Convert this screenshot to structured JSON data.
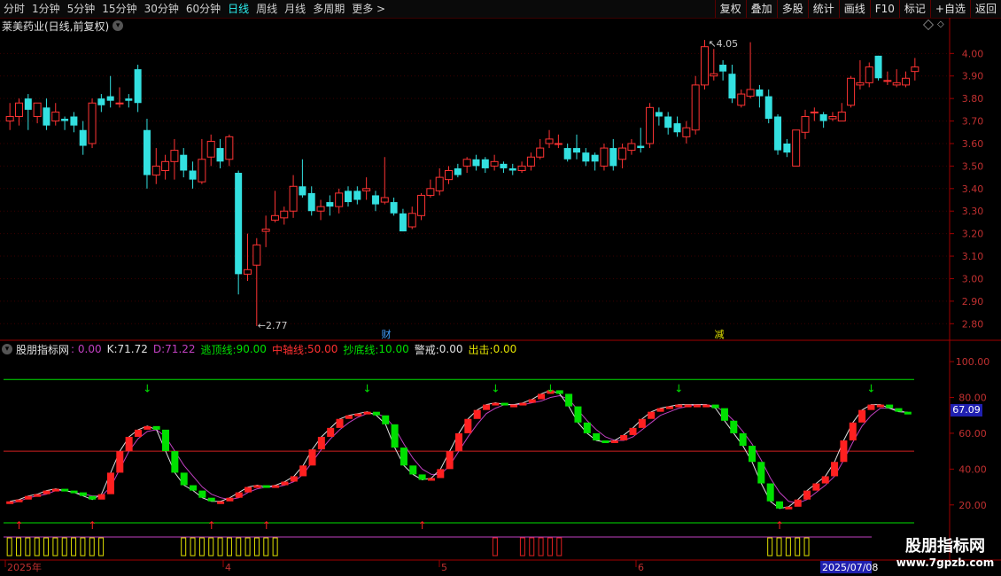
{
  "toolbar": {
    "periods": [
      "分时",
      "1分钟",
      "5分钟",
      "15分钟",
      "30分钟",
      "60分钟",
      "日线",
      "周线",
      "月线",
      "多周期",
      "更多 >"
    ],
    "active_period": "日线",
    "right_buttons": [
      "复权",
      "叠加",
      "多股",
      "统计",
      "画线",
      "F10",
      "标记",
      "+自选",
      "返回"
    ]
  },
  "stock": {
    "title": "莱美药业(日线,前复权)",
    "high_label": "4.05",
    "low_label": "2.77",
    "events": [
      "财",
      "减"
    ]
  },
  "indicator": {
    "name": "股朋指标网",
    "k_label": "K:",
    "k_value": "71.72",
    "d_label": "D:",
    "d_value": "71.22",
    "top_label": "逃顶线:",
    "top_value": "90.00",
    "mid_label": "中轴线:",
    "mid_value": "50.00",
    "bottom_label": "抄底线:",
    "bottom_value": "10.00",
    "warn_label": "警戒:",
    "warn_value": "0.00",
    "out_label": "出击:",
    "out_value": "0.00",
    "first_value": ": 0.00",
    "current_value": "67.09"
  },
  "watermark": {
    "line1": "股朋指标网",
    "line2": "www.7gpzb.com"
  },
  "date_axis": {
    "labels": [
      "2025年",
      "4",
      "5",
      "6"
    ],
    "cursor_date": "2025/07/08"
  },
  "colors": {
    "up": "#ff3333",
    "down": "#33e0e0",
    "green": "#00e000",
    "red_line": "#d02020",
    "purple": "#c040c0",
    "yellow": "#e0e000"
  },
  "chart_data": [
    {
      "type": "candlestick",
      "y_ticks": [
        4.0,
        3.9,
        3.8,
        3.7,
        3.6,
        3.5,
        3.4,
        3.3,
        3.2,
        3.1,
        3.0,
        2.9,
        2.8
      ],
      "ylim": [
        2.75,
        4.08
      ],
      "candles": [
        [
          3.7,
          3.72,
          3.78,
          3.66
        ],
        [
          3.72,
          3.78,
          3.8,
          3.68
        ],
        [
          3.8,
          3.75,
          3.82,
          3.66
        ],
        [
          3.72,
          3.78,
          3.78,
          3.69
        ],
        [
          3.76,
          3.68,
          3.8,
          3.66
        ],
        [
          3.7,
          3.74,
          3.78,
          3.68
        ],
        [
          3.71,
          3.7,
          3.72,
          3.66
        ],
        [
          3.72,
          3.68,
          3.74,
          3.65
        ],
        [
          3.66,
          3.59,
          3.7,
          3.55
        ],
        [
          3.6,
          3.78,
          3.8,
          3.58
        ],
        [
          3.8,
          3.77,
          3.82,
          3.74
        ],
        [
          3.81,
          3.79,
          3.9,
          3.76
        ],
        [
          3.78,
          3.78,
          3.85,
          3.76
        ],
        [
          3.8,
          3.79,
          3.82,
          3.76
        ],
        [
          3.93,
          3.78,
          3.95,
          3.74
        ],
        [
          3.66,
          3.46,
          3.71,
          3.4
        ],
        [
          3.46,
          3.5,
          3.58,
          3.42
        ],
        [
          3.48,
          3.52,
          3.55,
          3.44
        ],
        [
          3.52,
          3.57,
          3.62,
          3.44
        ],
        [
          3.55,
          3.48,
          3.58,
          3.45
        ],
        [
          3.48,
          3.44,
          3.52,
          3.4
        ],
        [
          3.43,
          3.53,
          3.62,
          3.42
        ],
        [
          3.54,
          3.61,
          3.64,
          3.5
        ],
        [
          3.58,
          3.52,
          3.62,
          3.49
        ],
        [
          3.53,
          3.63,
          3.64,
          3.5
        ],
        [
          3.47,
          3.02,
          3.48,
          2.93
        ],
        [
          3.02,
          3.04,
          3.2,
          2.99
        ],
        [
          3.06,
          3.15,
          3.18,
          2.79
        ],
        [
          3.21,
          3.22,
          3.28,
          3.14
        ],
        [
          3.26,
          3.28,
          3.39,
          3.25
        ],
        [
          3.27,
          3.3,
          3.32,
          3.24
        ],
        [
          3.3,
          3.41,
          3.46,
          3.27
        ],
        [
          3.41,
          3.37,
          3.53,
          3.36
        ],
        [
          3.38,
          3.3,
          3.41,
          3.28
        ],
        [
          3.3,
          3.32,
          3.35,
          3.26
        ],
        [
          3.34,
          3.32,
          3.37,
          3.28
        ],
        [
          3.32,
          3.38,
          3.4,
          3.29
        ],
        [
          3.39,
          3.34,
          3.41,
          3.32
        ],
        [
          3.39,
          3.35,
          3.41,
          3.33
        ],
        [
          3.39,
          3.4,
          3.45,
          3.35
        ],
        [
          3.37,
          3.33,
          3.39,
          3.3
        ],
        [
          3.34,
          3.36,
          3.54,
          3.33
        ],
        [
          3.34,
          3.29,
          3.36,
          3.28
        ],
        [
          3.29,
          3.21,
          3.31,
          3.21
        ],
        [
          3.23,
          3.29,
          3.32,
          3.22
        ],
        [
          3.28,
          3.37,
          3.38,
          3.26
        ],
        [
          3.37,
          3.4,
          3.44,
          3.36
        ],
        [
          3.39,
          3.45,
          3.49,
          3.37
        ],
        [
          3.44,
          3.48,
          3.5,
          3.42
        ],
        [
          3.49,
          3.46,
          3.51,
          3.45
        ],
        [
          3.5,
          3.53,
          3.54,
          3.47
        ],
        [
          3.53,
          3.5,
          3.55,
          3.48
        ],
        [
          3.53,
          3.49,
          3.54,
          3.47
        ],
        [
          3.5,
          3.52,
          3.55,
          3.48
        ],
        [
          3.51,
          3.49,
          3.52,
          3.47
        ],
        [
          3.49,
          3.48,
          3.51,
          3.46
        ],
        [
          3.48,
          3.5,
          3.52,
          3.47
        ],
        [
          3.5,
          3.54,
          3.56,
          3.48
        ],
        [
          3.54,
          3.58,
          3.62,
          3.53
        ],
        [
          3.6,
          3.62,
          3.66,
          3.58
        ],
        [
          3.6,
          3.6,
          3.64,
          3.58
        ],
        [
          3.58,
          3.53,
          3.6,
          3.52
        ],
        [
          3.58,
          3.56,
          3.64,
          3.53
        ],
        [
          3.56,
          3.52,
          3.58,
          3.5
        ],
        [
          3.55,
          3.52,
          3.56,
          3.48
        ],
        [
          3.5,
          3.58,
          3.6,
          3.48
        ],
        [
          3.58,
          3.5,
          3.62,
          3.48
        ],
        [
          3.53,
          3.58,
          3.6,
          3.49
        ],
        [
          3.57,
          3.6,
          3.62,
          3.55
        ],
        [
          3.59,
          3.58,
          3.67,
          3.56
        ],
        [
          3.6,
          3.76,
          3.78,
          3.58
        ],
        [
          3.74,
          3.72,
          3.76,
          3.68
        ],
        [
          3.72,
          3.67,
          3.74,
          3.64
        ],
        [
          3.69,
          3.65,
          3.72,
          3.63
        ],
        [
          3.63,
          3.67,
          3.7,
          3.6
        ],
        [
          3.66,
          3.86,
          3.9,
          3.64
        ],
        [
          3.86,
          4.03,
          4.06,
          3.84
        ],
        [
          3.9,
          3.91,
          4.02,
          3.88
        ],
        [
          3.95,
          3.92,
          3.97,
          3.88
        ],
        [
          3.91,
          3.8,
          3.95,
          3.78
        ],
        [
          3.77,
          3.82,
          3.84,
          3.76
        ],
        [
          3.81,
          3.84,
          4.05,
          3.8
        ],
        [
          3.84,
          3.81,
          3.86,
          3.76
        ],
        [
          3.81,
          3.71,
          3.84,
          3.69
        ],
        [
          3.72,
          3.57,
          3.73,
          3.55
        ],
        [
          3.6,
          3.56,
          3.62,
          3.54
        ],
        [
          3.5,
          3.66,
          3.66,
          3.5
        ],
        [
          3.65,
          3.72,
          3.75,
          3.62
        ],
        [
          3.74,
          3.74,
          3.76,
          3.7
        ],
        [
          3.73,
          3.7,
          3.74,
          3.67
        ],
        [
          3.71,
          3.72,
          3.74,
          3.7
        ],
        [
          3.7,
          3.74,
          3.78,
          3.7
        ],
        [
          3.77,
          3.89,
          3.9,
          3.76
        ],
        [
          3.86,
          3.87,
          3.97,
          3.84
        ],
        [
          3.87,
          3.94,
          3.96,
          3.85
        ],
        [
          3.99,
          3.89,
          3.99,
          3.88
        ],
        [
          3.88,
          3.88,
          3.92,
          3.86
        ],
        [
          3.86,
          3.87,
          3.93,
          3.85
        ],
        [
          3.86,
          3.89,
          3.92,
          3.85
        ],
        [
          3.92,
          3.94,
          3.98,
          3.88
        ]
      ]
    },
    {
      "type": "line",
      "y_ticks": [
        100,
        80,
        60,
        40,
        20
      ],
      "ylim": [
        10,
        103
      ],
      "series": [
        {
          "name": "K",
          "values": [
            22,
            23,
            25,
            26,
            28,
            29,
            28,
            27,
            25,
            23,
            26,
            38,
            50,
            58,
            62,
            64,
            62,
            50,
            38,
            31,
            28,
            24,
            22,
            22,
            24,
            27,
            30,
            31,
            30,
            31,
            33,
            36,
            42,
            51,
            58,
            63,
            68,
            70,
            71,
            72,
            70,
            65,
            52,
            42,
            37,
            34,
            35,
            40,
            50,
            60,
            68,
            73,
            76,
            77,
            76,
            76,
            77,
            79,
            82,
            84,
            82,
            75,
            66,
            60,
            56,
            55,
            56,
            59,
            63,
            68,
            72,
            74,
            75,
            76,
            76,
            76,
            76,
            74,
            67,
            60,
            53,
            44,
            32,
            22,
            18,
            19,
            23,
            28,
            32,
            36,
            44,
            56,
            66,
            73,
            76,
            76,
            74,
            72,
            71.72
          ]
        },
        {
          "name": "D",
          "values": [
            21,
            22,
            24,
            25,
            26,
            28,
            28,
            27,
            26,
            25,
            25,
            30,
            40,
            50,
            57,
            61,
            62,
            58,
            50,
            42,
            36,
            30,
            26,
            24,
            23,
            24,
            27,
            29,
            30,
            30,
            31,
            33,
            37,
            44,
            51,
            57,
            62,
            66,
            69,
            71,
            71,
            69,
            63,
            54,
            46,
            40,
            37,
            37,
            42,
            50,
            58,
            65,
            71,
            74,
            76,
            76,
            76,
            77,
            78,
            80,
            81,
            79,
            73,
            67,
            62,
            58,
            56,
            56,
            58,
            62,
            66,
            70,
            72,
            74,
            75,
            76,
            76,
            75,
            72,
            67,
            61,
            54,
            45,
            35,
            27,
            22,
            21,
            23,
            27,
            31,
            36,
            45,
            55,
            64,
            70,
            74,
            74,
            73,
            71.22
          ]
        }
      ],
      "lines": {
        "top": 90,
        "mid": 50,
        "bottom": 10
      }
    }
  ]
}
